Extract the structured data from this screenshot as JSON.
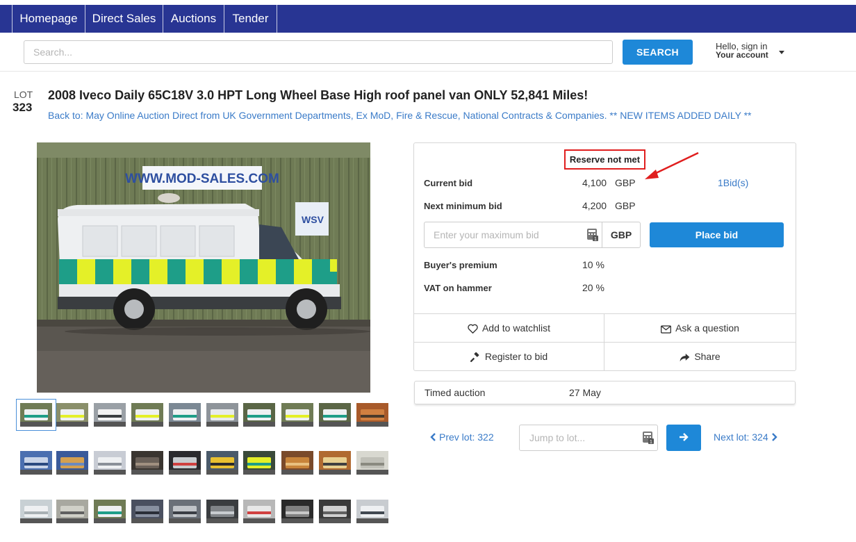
{
  "nav": {
    "items": [
      {
        "label": "Homepage"
      },
      {
        "label": "Direct Sales"
      },
      {
        "label": "Auctions"
      },
      {
        "label": "Tender"
      }
    ]
  },
  "search": {
    "placeholder": "Search...",
    "button_label": "SEARCH"
  },
  "account": {
    "greeting": "Hello, sign in",
    "label": "Your account"
  },
  "lot": {
    "label": "LOT",
    "number": "323",
    "title": "2008 Iveco Daily 65C18V 3.0 HPT Long Wheel Base High roof panel van ONLY 52,841 Miles!",
    "back_link": "Back to: May Online Auction Direct from UK Government Departments, Ex MoD, Fire & Rescue, National Contracts & Companies. ** NEW ITEMS ADDED DAILY **"
  },
  "photo": {
    "sign_text": "WWW.MOD-SALES.COM",
    "logo_text": "WSV"
  },
  "bid_panel": {
    "reserve_status": "Reserve not met",
    "current_bid_label": "Current bid",
    "current_bid_value": "4,100",
    "current_bid_currency": "GBP",
    "bids_count": "1Bid(s)",
    "next_min_label": "Next minimum bid",
    "next_min_value": "4,200",
    "next_min_currency": "GBP",
    "max_bid_placeholder": "Enter your maximum bid",
    "bid_currency": "GBP",
    "place_bid_label": "Place bid",
    "buyers_premium_label": "Buyer's premium",
    "buyers_premium_value": "10 %",
    "vat_label": "VAT on hammer",
    "vat_value": "20 %",
    "actions": {
      "watchlist": "Add to watchlist",
      "ask": "Ask a question",
      "register": "Register to bid",
      "share": "Share"
    }
  },
  "timed": {
    "label": "Timed auction",
    "date": "27 May"
  },
  "lot_nav": {
    "prev": "Prev lot: 322",
    "jump_placeholder": "Jump to lot...",
    "next": "Next lot: 324"
  },
  "colors": {
    "nav_bg": "#283593",
    "accent": "#1e88d8",
    "link": "#3a7bc8",
    "annotation": "#e01e1e"
  }
}
